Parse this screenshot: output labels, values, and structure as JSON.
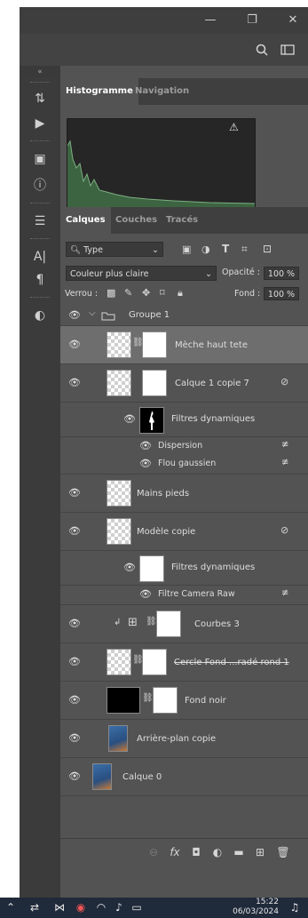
{
  "window": {
    "minimize_icon": "—",
    "restore_icon": "❐",
    "close_icon": "✕"
  },
  "collapse_label": "«",
  "histogram_tabs": [
    {
      "label": "Histogramme",
      "active": true
    },
    {
      "label": "Navigation",
      "active": false
    }
  ],
  "histogram_warning": "⚠",
  "layers_tabs": [
    {
      "label": "Calques",
      "active": true
    },
    {
      "label": "Couches",
      "active": false
    },
    {
      "label": "Tracés",
      "active": false
    }
  ],
  "filter": {
    "kind": "Type",
    "chevron": "⌄"
  },
  "blend_mode": {
    "value": "Couleur plus claire",
    "chevron": "⌄"
  },
  "opacity": {
    "label": "Opacité :",
    "value": "100 %"
  },
  "lock": {
    "label": "Verrou :"
  },
  "fill": {
    "label": "Fond :",
    "value": "100 %"
  },
  "layers": {
    "group": {
      "name": "Groupe 1"
    },
    "meche": {
      "name": "Mèche haut tete"
    },
    "calque1copie7": {
      "name": "Calque 1 copie 7"
    },
    "filtres1": {
      "name": "Filtres dynamiques"
    },
    "dispersion": {
      "name": "Dispersion"
    },
    "flou": {
      "name": "Flou gaussien"
    },
    "mains": {
      "name": "Mains pieds"
    },
    "modele": {
      "name": "Modèle copie"
    },
    "filtres2": {
      "name": "Filtres dynamiques"
    },
    "cameraraw": {
      "name": "Filtre Camera Raw"
    },
    "courbes": {
      "name": "Courbes 3"
    },
    "cercle": {
      "name": "Cercle Fond ...radé rond 1"
    },
    "fondnoir": {
      "name": "Fond noir"
    },
    "arriere": {
      "name": "Arrière-plan copie"
    },
    "calque0": {
      "name": "Calque 0"
    }
  },
  "taskbar": {
    "time": "15:22",
    "date": "06/03/2024"
  }
}
